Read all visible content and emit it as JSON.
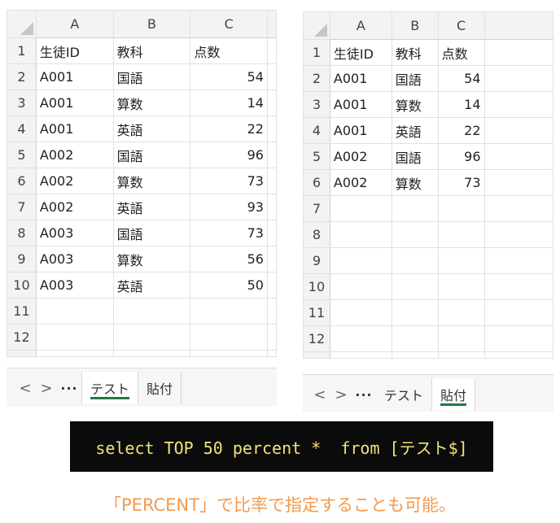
{
  "left_sheet": {
    "columns": [
      "A",
      "B",
      "C"
    ],
    "rows": [
      {
        "row": "1",
        "a": "生徒ID",
        "b": "教科",
        "c": "点数"
      },
      {
        "row": "2",
        "a": "A001",
        "b": "国語",
        "c": "54"
      },
      {
        "row": "3",
        "a": "A001",
        "b": "算数",
        "c": "14"
      },
      {
        "row": "4",
        "a": "A001",
        "b": "英語",
        "c": "22"
      },
      {
        "row": "5",
        "a": "A002",
        "b": "国語",
        "c": "96"
      },
      {
        "row": "6",
        "a": "A002",
        "b": "算数",
        "c": "73"
      },
      {
        "row": "7",
        "a": "A002",
        "b": "英語",
        "c": "93"
      },
      {
        "row": "8",
        "a": "A003",
        "b": "国語",
        "c": "73"
      },
      {
        "row": "9",
        "a": "A003",
        "b": "算数",
        "c": "56"
      },
      {
        "row": "10",
        "a": "A003",
        "b": "英語",
        "c": "50"
      },
      {
        "row": "11",
        "a": "",
        "b": "",
        "c": ""
      },
      {
        "row": "12",
        "a": "",
        "b": "",
        "c": ""
      }
    ],
    "tabs": {
      "prev": "<",
      "next": ">",
      "more": "···",
      "sheet1": "テスト",
      "sheet2": "貼付"
    },
    "active_tab": "テスト"
  },
  "right_sheet": {
    "columns": [
      "A",
      "B",
      "C"
    ],
    "rows": [
      {
        "row": "1",
        "a": "生徒ID",
        "b": "教科",
        "c": "点数"
      },
      {
        "row": "2",
        "a": "A001",
        "b": "国語",
        "c": "54"
      },
      {
        "row": "3",
        "a": "A001",
        "b": "算数",
        "c": "14"
      },
      {
        "row": "4",
        "a": "A001",
        "b": "英語",
        "c": "22"
      },
      {
        "row": "5",
        "a": "A002",
        "b": "国語",
        "c": "96"
      },
      {
        "row": "6",
        "a": "A002",
        "b": "算数",
        "c": "73"
      },
      {
        "row": "7",
        "a": "",
        "b": "",
        "c": ""
      },
      {
        "row": "8",
        "a": "",
        "b": "",
        "c": ""
      },
      {
        "row": "9",
        "a": "",
        "b": "",
        "c": ""
      },
      {
        "row": "10",
        "a": "",
        "b": "",
        "c": ""
      },
      {
        "row": "11",
        "a": "",
        "b": "",
        "c": ""
      },
      {
        "row": "12",
        "a": "",
        "b": "",
        "c": ""
      }
    ],
    "tabs": {
      "prev": "<",
      "next": ">",
      "more": "···",
      "sheet1": "テスト",
      "sheet2": "貼付"
    },
    "active_tab": "貼付"
  },
  "sql": "select TOP 50 percent *  from [テスト$]",
  "caption": "「PERCENT」で比率で指定することも可能。",
  "colors": {
    "accent": "#1e7b46",
    "caption": "#f39a4c",
    "sql_text": "#f3e27a"
  }
}
